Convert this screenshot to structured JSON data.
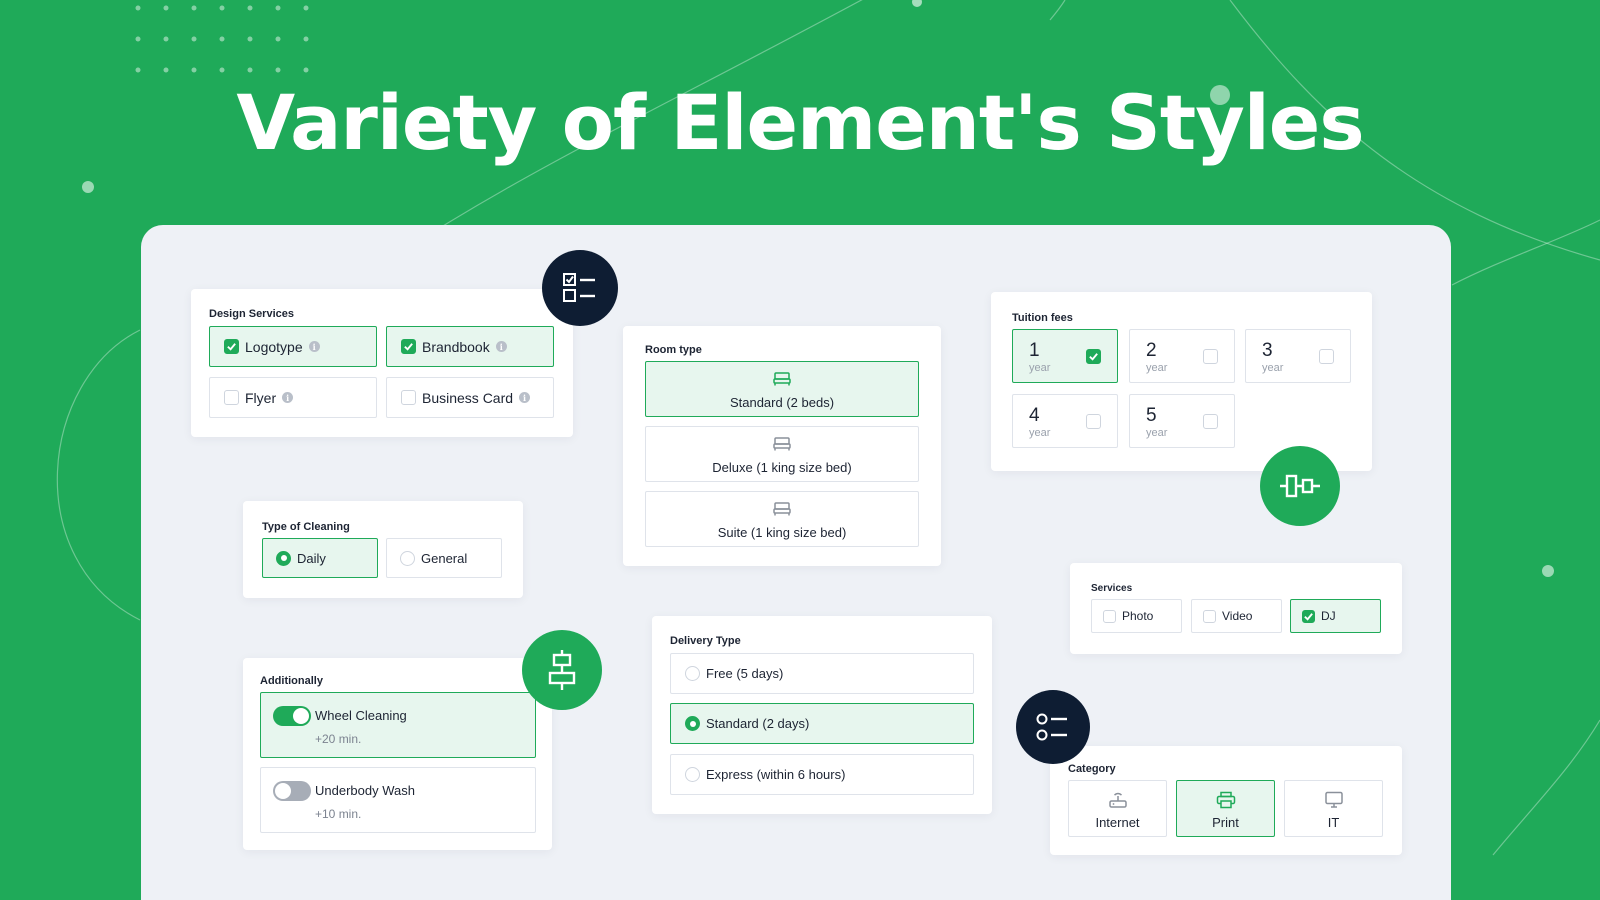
{
  "hero": {
    "title": "Variety of Element's Styles"
  },
  "colors": {
    "brand": "#1faa59",
    "dark": "#0e1d33",
    "panel": "#eef1f6"
  },
  "design_services": {
    "title": "Design Services",
    "options": [
      {
        "label": "Logotype",
        "checked": true
      },
      {
        "label": "Brandbook",
        "checked": true
      },
      {
        "label": "Flyer",
        "checked": false
      },
      {
        "label": "Business Card",
        "checked": false
      }
    ]
  },
  "cleaning": {
    "title": "Type of Cleaning",
    "options": [
      {
        "label": "Daily",
        "selected": true
      },
      {
        "label": "General",
        "selected": false
      }
    ]
  },
  "additionally": {
    "title": "Additionally",
    "options": [
      {
        "label": "Wheel Cleaning",
        "sub": "+20 min.",
        "on": true
      },
      {
        "label": "Underbody Wash",
        "sub": "+10 min.",
        "on": false
      }
    ]
  },
  "room": {
    "title": "Room type",
    "options": [
      {
        "label": "Standard (2 beds)",
        "selected": true
      },
      {
        "label": "Deluxe (1 king size bed)",
        "selected": false
      },
      {
        "label": "Suite (1 king size bed)",
        "selected": false
      }
    ],
    "icon": "bed-icon"
  },
  "delivery": {
    "title": "Delivery Type",
    "options": [
      {
        "label": "Free (5 days)",
        "selected": false
      },
      {
        "label": "Standard (2 days)",
        "selected": true
      },
      {
        "label": "Express (within 6 hours)",
        "selected": false
      }
    ]
  },
  "tuition": {
    "title": "Tuition fees",
    "unit": "year",
    "options": [
      {
        "num": "1",
        "checked": true
      },
      {
        "num": "2",
        "checked": false
      },
      {
        "num": "3",
        "checked": false
      },
      {
        "num": "4",
        "checked": false
      },
      {
        "num": "5",
        "checked": false
      }
    ]
  },
  "services": {
    "title": "Services",
    "options": [
      {
        "label": "Photo",
        "checked": false
      },
      {
        "label": "Video",
        "checked": false
      },
      {
        "label": "DJ",
        "checked": true
      }
    ]
  },
  "category": {
    "title": "Category",
    "options": [
      {
        "label": "Internet",
        "icon": "router-icon",
        "selected": false
      },
      {
        "label": "Print",
        "icon": "printer-icon",
        "selected": true
      },
      {
        "label": "IT",
        "icon": "monitor-icon",
        "selected": false
      }
    ]
  },
  "badges": [
    "checklist-icon",
    "align-horizontal-icon",
    "align-vertical-icon",
    "radio-list-icon"
  ]
}
